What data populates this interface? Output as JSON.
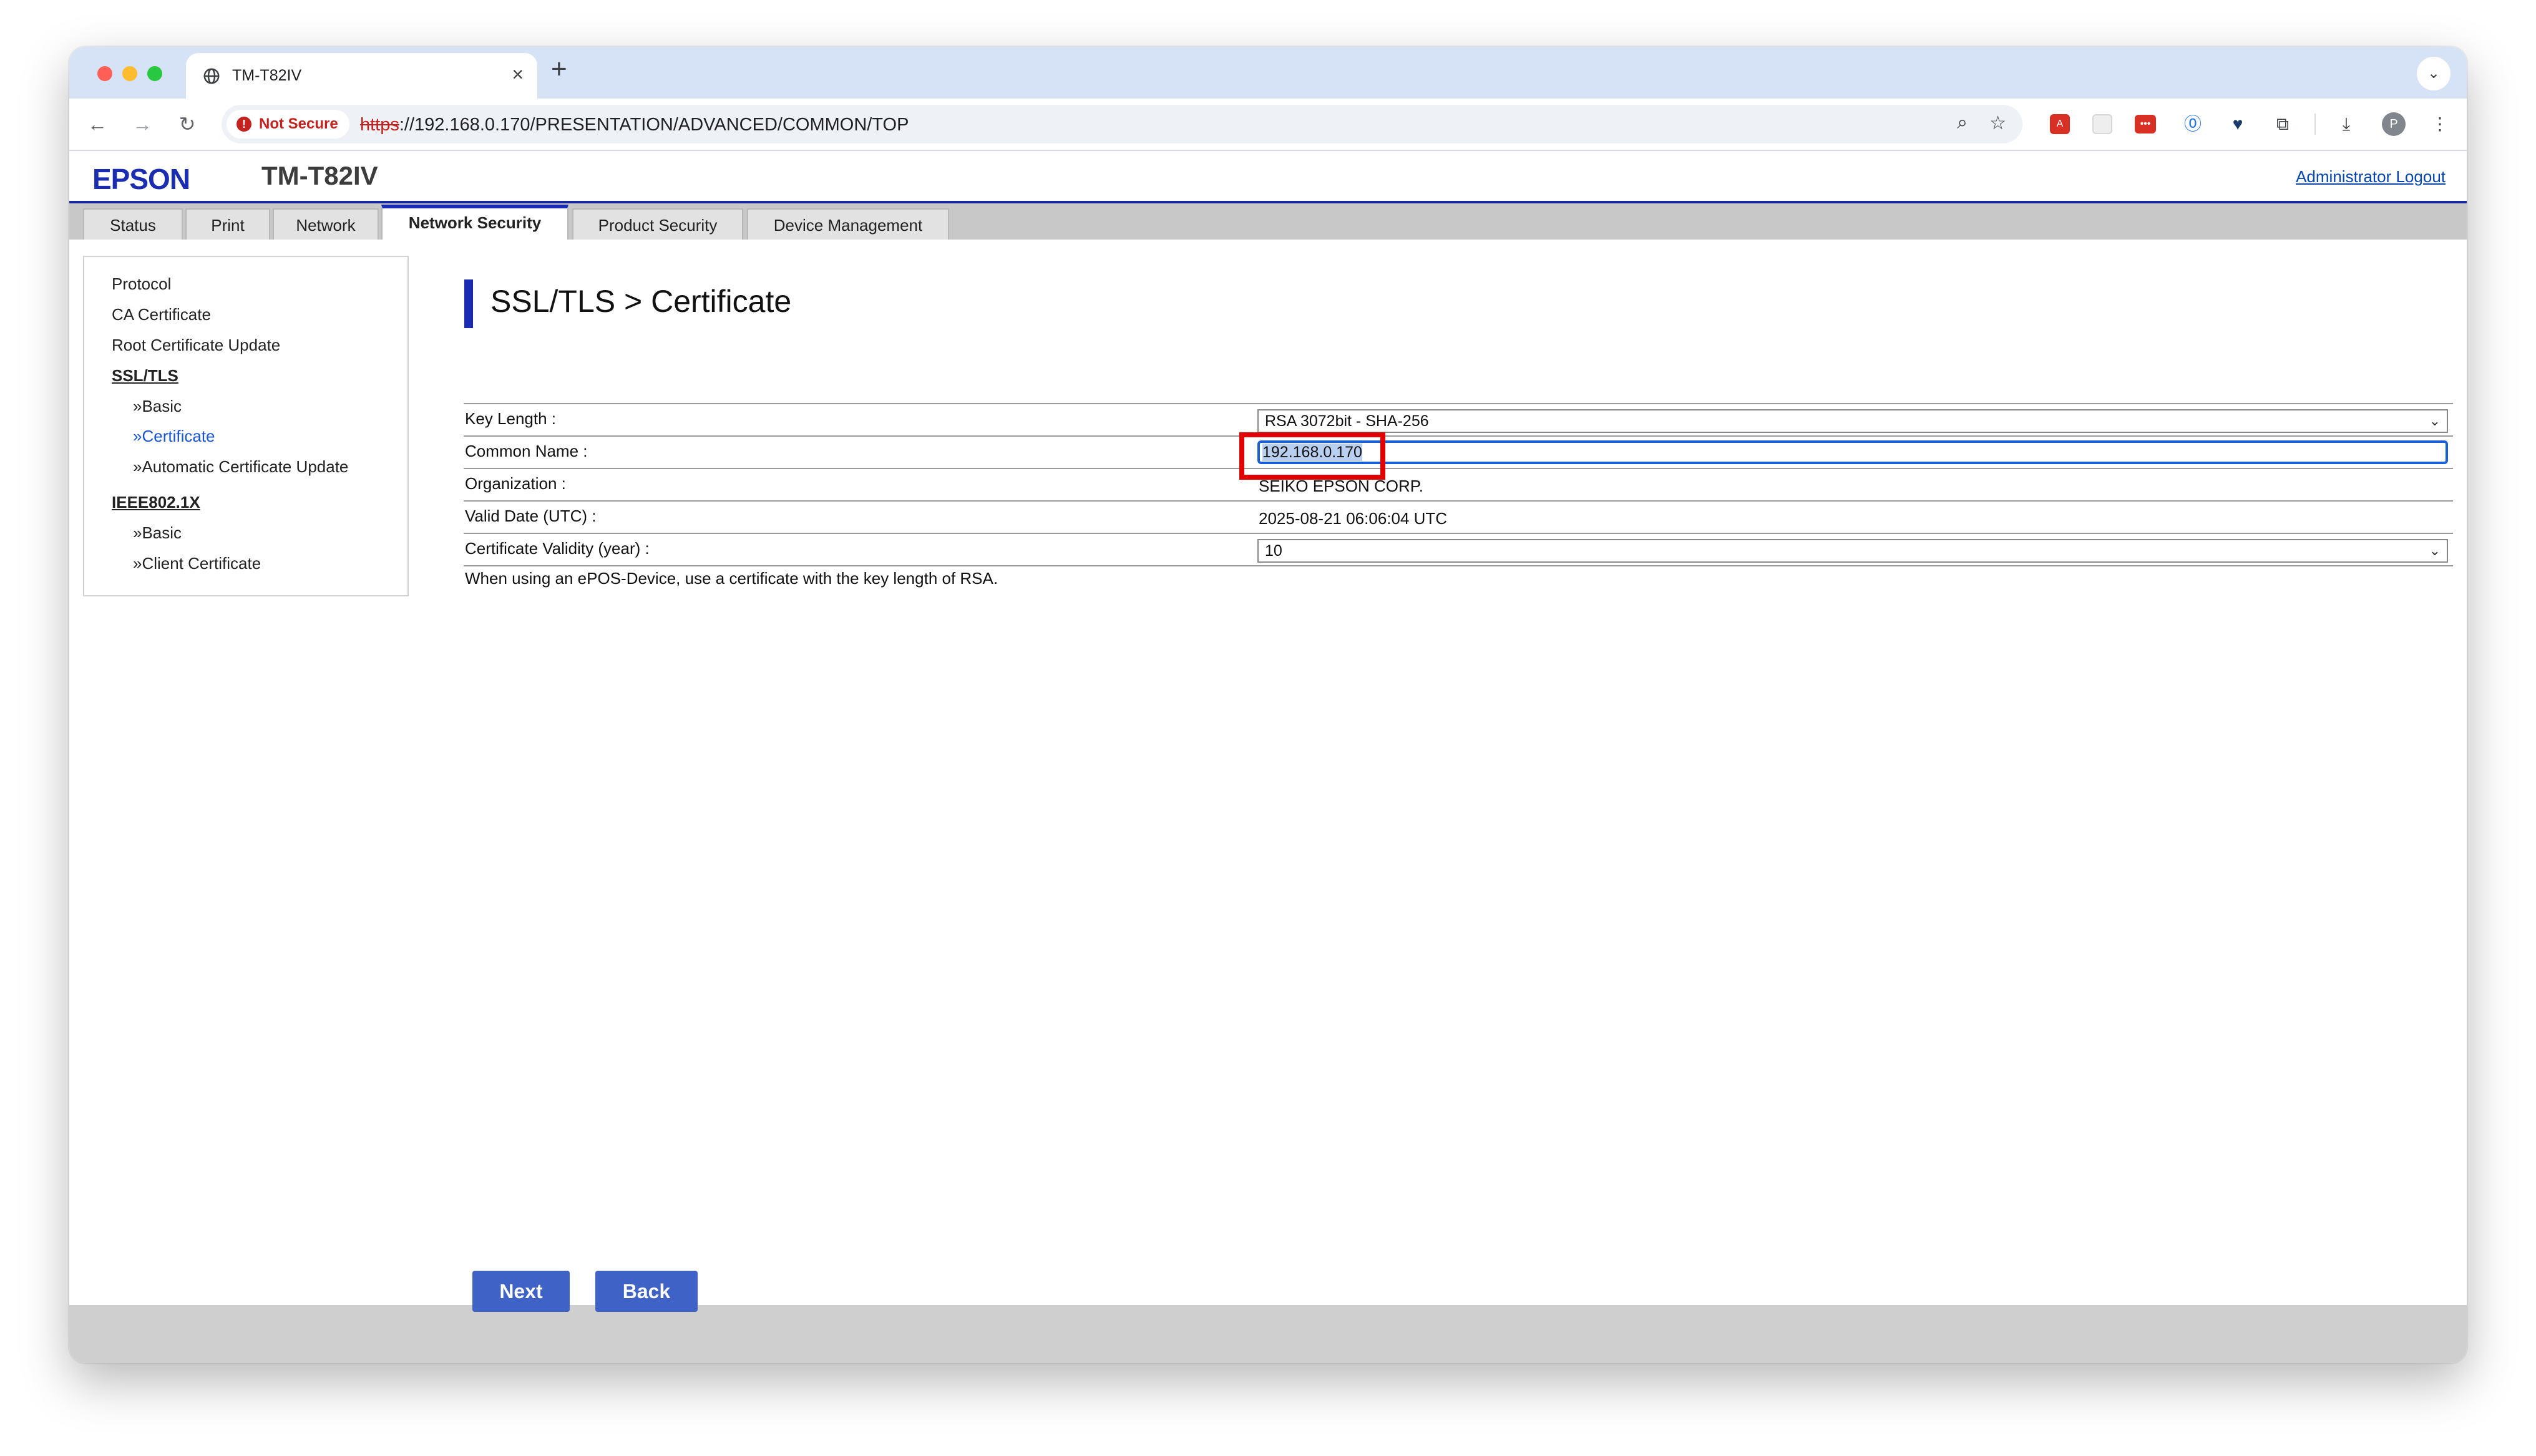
{
  "browser": {
    "tab_title": "TM-T82IV",
    "new_tab_label": "+",
    "close_label": "×",
    "security_label": "Not Secure",
    "url_scheme": "https",
    "url_rest": "://192.168.0.170/PRESENTATION/ADVANCED/COMMON/TOP",
    "avatar_letter": "P"
  },
  "header": {
    "brand": "EPSON",
    "model": "TM-T82IV",
    "logout": "Administrator Logout"
  },
  "tabs": [
    {
      "label": "Status"
    },
    {
      "label": "Print"
    },
    {
      "label": "Network"
    },
    {
      "label": "Network Security",
      "active": true
    },
    {
      "label": "Product Security"
    },
    {
      "label": "Device Management"
    }
  ],
  "sidebar": {
    "items": [
      {
        "label": "Protocol"
      },
      {
        "label": "CA Certificate"
      },
      {
        "label": "Root Certificate Update"
      },
      {
        "label": "SSL/TLS"
      },
      {
        "label": "»Basic"
      },
      {
        "label": "»Certificate"
      },
      {
        "label": "»Automatic Certificate Update"
      },
      {
        "label": "IEEE802.1X"
      },
      {
        "label": "»Basic"
      },
      {
        "label": "»Client Certificate"
      }
    ]
  },
  "main": {
    "title": "SSL/TLS > Certificate",
    "rows": [
      {
        "label": "Key Length :",
        "value": "RSA 3072bit - SHA-256"
      },
      {
        "label": "Common Name :",
        "value": "192.168.0.170"
      },
      {
        "label": "Organization :",
        "value": "SEIKO EPSON CORP."
      },
      {
        "label": "Valid Date (UTC) :",
        "value": "2025-08-21 06:06:04 UTC"
      },
      {
        "label": "Certificate Validity (year) :",
        "value": "10"
      }
    ],
    "note": "When using an ePOS-Device, use a certificate with the key length of RSA."
  },
  "buttons": {
    "next": "Next",
    "back": "Back"
  },
  "colors": {
    "brand_blue": "#1a2db0",
    "button_blue": "#3e62c6",
    "highlight_red": "#e00000",
    "link_blue": "#0645ad"
  }
}
